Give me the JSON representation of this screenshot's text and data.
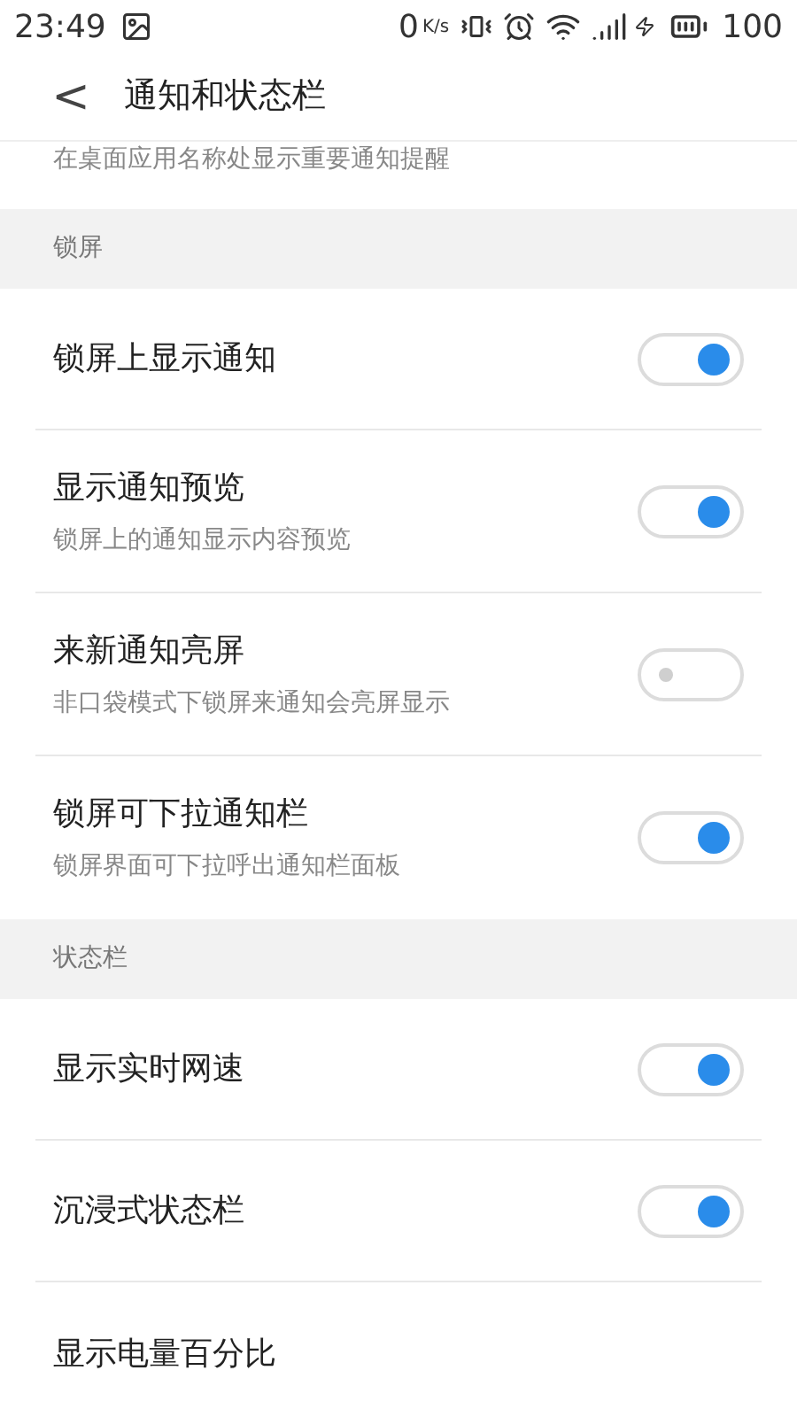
{
  "status_bar": {
    "time": "23:49",
    "speed_value": "0",
    "speed_unit": "K/s",
    "battery": "100"
  },
  "header": {
    "back": "<",
    "title": "通知和状态栏"
  },
  "partial_row": {
    "subtitle": "在桌面应用名称处显示重要通知提醒"
  },
  "sections": [
    {
      "title": "锁屏",
      "rows": [
        {
          "title": "锁屏上显示通知",
          "on": true
        },
        {
          "title": "显示通知预览",
          "subtitle": "锁屏上的通知显示内容预览",
          "on": true
        },
        {
          "title": "来新通知亮屏",
          "subtitle": "非口袋模式下锁屏来通知会亮屏显示",
          "on": false
        },
        {
          "title": "锁屏可下拉通知栏",
          "subtitle": "锁屏界面可下拉呼出通知栏面板",
          "on": true
        }
      ]
    },
    {
      "title": "状态栏",
      "rows": [
        {
          "title": "显示实时网速",
          "on": true
        },
        {
          "title": "沉浸式状态栏",
          "on": true
        },
        {
          "title": "显示电量百分比"
        }
      ]
    }
  ]
}
